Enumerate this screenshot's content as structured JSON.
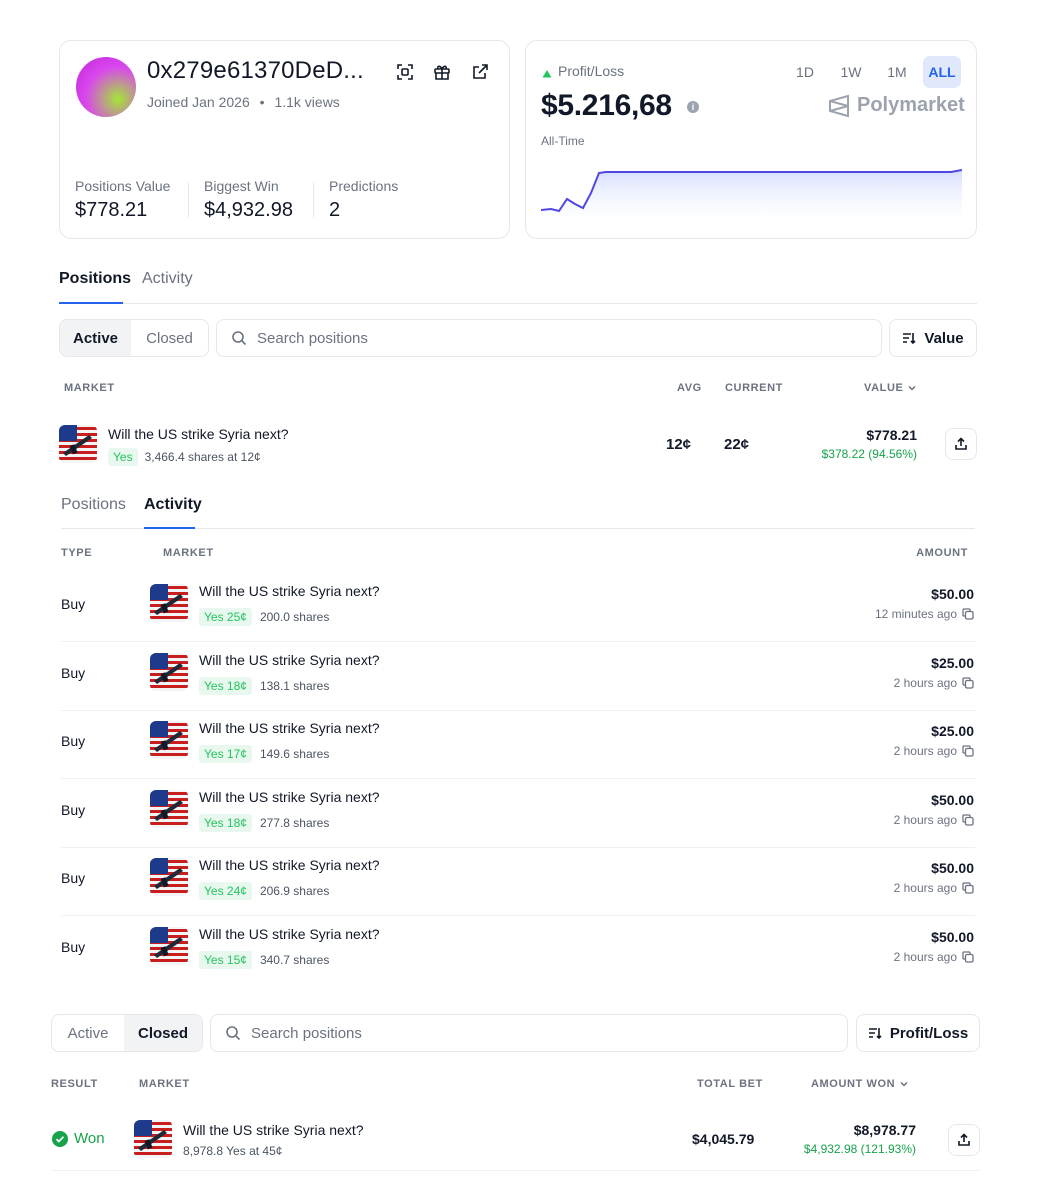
{
  "profile": {
    "address": "0x279e61370DeD...",
    "joined": "Joined Jan 2026",
    "views": "1.1k views",
    "stats": [
      {
        "label": "Positions Value",
        "value": "$778.21"
      },
      {
        "label": "Biggest Win",
        "value": "$4,932.98"
      },
      {
        "label": "Predictions",
        "value": "2"
      }
    ]
  },
  "pnl": {
    "label": "Profit/Loss",
    "value": "$5.216,68",
    "period": "All-Time",
    "ranges": [
      "1D",
      "1W",
      "1M",
      "ALL"
    ],
    "active_range": "ALL",
    "brand": "Polymarket",
    "accent": "#2563eb"
  },
  "main_tabs": [
    {
      "label": "Positions"
    },
    {
      "label": "Activity"
    }
  ],
  "positions": {
    "filter": {
      "active": "Active",
      "closed": "Closed"
    },
    "search_placeholder": "Search positions",
    "sort_label": "Value",
    "headers": {
      "market": "MARKET",
      "avg": "AVG",
      "current": "CURRENT",
      "value": "VALUE"
    },
    "row": {
      "title": "Will the US strike Syria next?",
      "outcome": "Yes",
      "shares": "3,466.4 shares at 12¢",
      "avg": "12¢",
      "current": "22¢",
      "value": "$778.21",
      "pnl": "$378.22 (94.56%)"
    }
  },
  "activity_tabs": [
    {
      "label": "Positions"
    },
    {
      "label": "Activity"
    }
  ],
  "activity": {
    "headers": {
      "type": "TYPE",
      "market": "MARKET",
      "amount": "AMOUNT"
    },
    "rows": [
      {
        "type": "Buy",
        "title": "Will the US strike Syria next?",
        "outcome": "Yes 25¢",
        "shares": "200.0 shares",
        "amount": "$50.00",
        "time": "12 minutes ago"
      },
      {
        "type": "Buy",
        "title": "Will the US strike Syria next?",
        "outcome": "Yes 18¢",
        "shares": "138.1 shares",
        "amount": "$25.00",
        "time": "2 hours ago"
      },
      {
        "type": "Buy",
        "title": "Will the US strike Syria next?",
        "outcome": "Yes 17¢",
        "shares": "149.6 shares",
        "amount": "$25.00",
        "time": "2 hours ago"
      },
      {
        "type": "Buy",
        "title": "Will the US strike Syria next?",
        "outcome": "Yes 18¢",
        "shares": "277.8 shares",
        "amount": "$50.00",
        "time": "2 hours ago"
      },
      {
        "type": "Buy",
        "title": "Will the US strike Syria next?",
        "outcome": "Yes 24¢",
        "shares": "206.9 shares",
        "amount": "$50.00",
        "time": "2 hours ago"
      },
      {
        "type": "Buy",
        "title": "Will the US strike Syria next?",
        "outcome": "Yes 15¢",
        "shares": "340.7 shares",
        "amount": "$50.00",
        "time": "2 hours ago"
      }
    ]
  },
  "closed": {
    "filter": {
      "active": "Active",
      "closed": "Closed"
    },
    "search_placeholder": "Search positions",
    "sort_label": "Profit/Loss",
    "headers": {
      "result": "RESULT",
      "market": "MARKET",
      "total_bet": "TOTAL BET",
      "amount_won": "AMOUNT WON"
    },
    "row": {
      "result": "Won",
      "title": "Will the US strike Syria next?",
      "detail": "8,978.8 Yes at 45¢",
      "total_bet": "$4,045.79",
      "amount_won": "$8,978.77",
      "pnl": "$4,932.98 (121.93%)"
    }
  }
}
